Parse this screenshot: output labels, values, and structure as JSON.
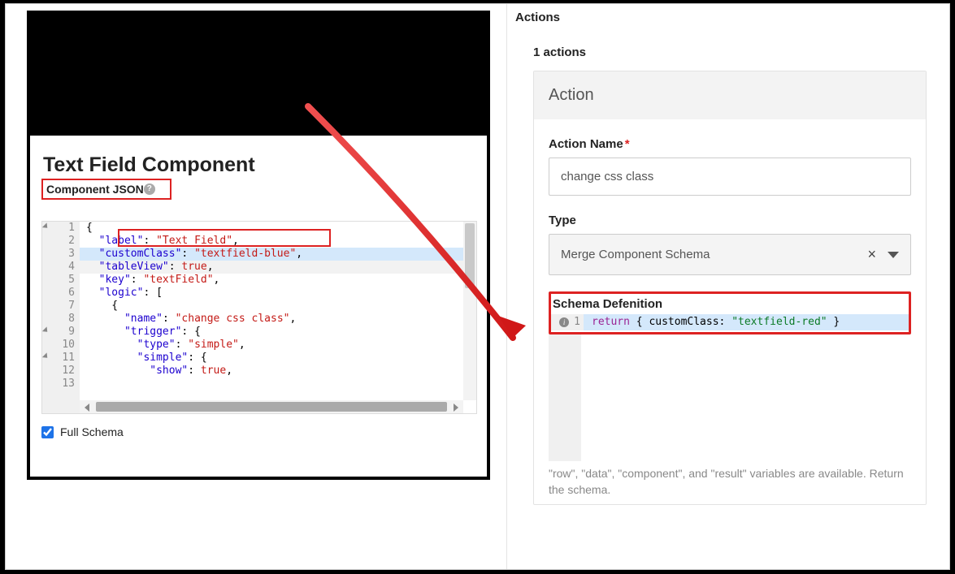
{
  "left": {
    "title": "Text Field Component",
    "json_label": "Component JSON",
    "full_schema_label": "Full Schema",
    "full_schema_checked": true,
    "code": {
      "lines": [
        "{",
        "  \"label\": \"Text Field\",",
        "  \"customClass\": \"textfield-blue\",",
        "  \"tableView\": true,",
        "  \"key\": \"textField\",",
        "  \"logic\": [",
        "    {",
        "      \"name\": \"change css class\",",
        "      \"trigger\": {",
        "        \"type\": \"simple\",",
        "        \"simple\": {",
        "          \"show\": true,",
        ""
      ]
    }
  },
  "right": {
    "header": "Actions",
    "count": "1 actions",
    "action_title": "Action",
    "name_label": "Action Name",
    "name_value": "change css class",
    "type_label": "Type",
    "type_value": "Merge Component Schema",
    "clear": "×",
    "schema_label": "Schema Defenition",
    "schema_line_no": "1",
    "schema_code_return": "return",
    "schema_code_mid": " { customClass: ",
    "schema_code_str": "\"textfield-red\"",
    "schema_code_end": " }",
    "hint": "\"row\", \"data\", \"component\", and \"result\" variables are available. Return the schema."
  }
}
